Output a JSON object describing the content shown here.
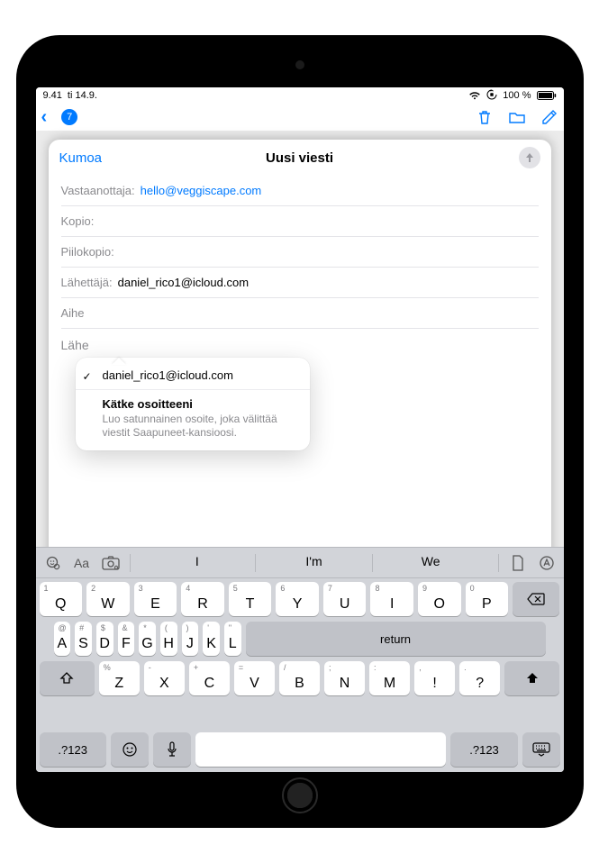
{
  "status": {
    "time": "9.41",
    "date": "ti 14.9.",
    "signal": "wifi",
    "battery_pct": "100 %"
  },
  "nav": {
    "unread_badge": "7"
  },
  "compose": {
    "cancel": "Kumoa",
    "title": "Uusi viesti",
    "to_label": "Vastaanottaja:",
    "to_value": "hello@veggiscape.com",
    "cc_label": "Kopio:",
    "bcc_label": "Piilokopio:",
    "from_label": "Lähettäjä:",
    "from_value": "daniel_rico1@icloud.com",
    "subject_label": "Aihe",
    "body_placeholder": "Lähe"
  },
  "popover": {
    "selected": "daniel_rico1@icloud.com",
    "hide_title": "Kätke osoitteeni",
    "hide_sub": "Luo satunnainen osoite, joka välittää viestit Saapuneet-kansioosi."
  },
  "keyboard": {
    "suggestions": [
      "I",
      "I'm",
      "We"
    ],
    "row1": [
      {
        "k": "Q",
        "h": "1"
      },
      {
        "k": "W",
        "h": "2"
      },
      {
        "k": "E",
        "h": "3"
      },
      {
        "k": "R",
        "h": "4"
      },
      {
        "k": "T",
        "h": "5"
      },
      {
        "k": "Y",
        "h": "6"
      },
      {
        "k": "U",
        "h": "7"
      },
      {
        "k": "I",
        "h": "8"
      },
      {
        "k": "O",
        "h": "9"
      },
      {
        "k": "P",
        "h": "0"
      }
    ],
    "row2": [
      {
        "k": "A",
        "h": "@"
      },
      {
        "k": "S",
        "h": "#"
      },
      {
        "k": "D",
        "h": "$"
      },
      {
        "k": "F",
        "h": "&"
      },
      {
        "k": "G",
        "h": "*"
      },
      {
        "k": "H",
        "h": "("
      },
      {
        "k": "J",
        "h": ")"
      },
      {
        "k": "K",
        "h": "'"
      },
      {
        "k": "L",
        "h": "\""
      }
    ],
    "row3": [
      {
        "k": "Z",
        "h": "%"
      },
      {
        "k": "X",
        "h": "-"
      },
      {
        "k": "C",
        "h": "+"
      },
      {
        "k": "V",
        "h": "="
      },
      {
        "k": "B",
        "h": "/"
      },
      {
        "k": "N",
        "h": ";"
      },
      {
        "k": "M",
        "h": ":"
      },
      {
        "k": "!",
        "h": ","
      },
      {
        "k": "?",
        "h": "."
      }
    ],
    "numkey": ".?123",
    "returnkey": "return"
  }
}
